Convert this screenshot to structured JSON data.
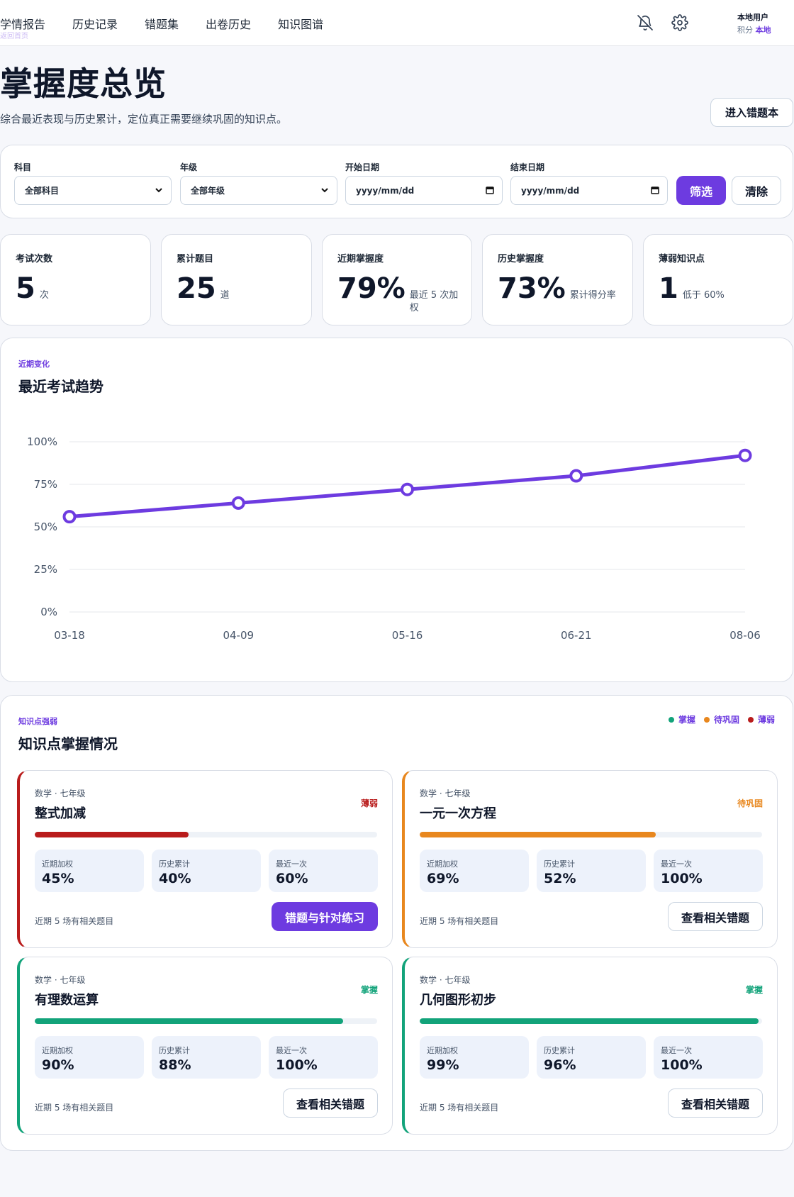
{
  "nav": {
    "links": [
      "学情报告",
      "历史记录",
      "错题集",
      "出卷历史",
      "知识图谱"
    ],
    "active_hint": "返回首页"
  },
  "user": {
    "name": "本地用户",
    "points_label": "积分",
    "points_value": "本地"
  },
  "icons": {
    "bell": "bell-off-icon",
    "settings": "gear-icon"
  },
  "header": {
    "title": "掌握度总览",
    "subtitle": "综合最近表现与历史累计，定位真正需要继续巩固的知识点。",
    "goto_button": "进入错题本"
  },
  "filters": {
    "subject_label": "科目",
    "subject_value": "全部科目",
    "grade_label": "年级",
    "grade_value": "全部年级",
    "start_label": "开始日期",
    "start_placeholder": "yyyy/mm/dd",
    "end_label": "结束日期",
    "end_placeholder": "yyyy/mm/dd",
    "filter_button": "筛选",
    "clear_button": "清除"
  },
  "stats": [
    {
      "label": "考试次数",
      "value": "5",
      "unit": "次"
    },
    {
      "label": "累计题目",
      "value": "25",
      "unit": "道"
    },
    {
      "label": "近期掌握度",
      "value": "79%",
      "unit": "最近 5 次加权"
    },
    {
      "label": "历史掌握度",
      "value": "73%",
      "unit": "累计得分率"
    },
    {
      "label": "薄弱知识点",
      "value": "1",
      "unit": "低于 60%"
    }
  ],
  "trend": {
    "eyebrow": "近期变化",
    "title": "最近考试趋势"
  },
  "chart_data": {
    "type": "line",
    "x": [
      "03-18",
      "04-09",
      "05-16",
      "06-21",
      "08-06"
    ],
    "series": [
      {
        "values": [
          56,
          64,
          72,
          80,
          92
        ]
      }
    ],
    "ylim": [
      0,
      100
    ],
    "yticks": [
      "0%",
      "25%",
      "50%",
      "75%",
      "100%"
    ],
    "ytick_values": [
      0,
      25,
      50,
      75,
      100
    ],
    "grid": true,
    "color": "#6d3be0"
  },
  "knowledge": {
    "eyebrow": "知识点强弱",
    "title": "知识点掌握情况",
    "legend": [
      {
        "label": "掌握",
        "color": "#12a37a"
      },
      {
        "label": "待巩固",
        "color": "#e8871e"
      },
      {
        "label": "薄弱",
        "color": "#b91c1c"
      }
    ],
    "metric_labels": [
      "近期加权",
      "历史累计",
      "最近一次"
    ],
    "items": [
      {
        "meta": "数学 · 七年级",
        "name": "整式加减",
        "status": "薄弱",
        "color": "#b91c1c",
        "progress": 0.45,
        "recent": "45%",
        "history": "40%",
        "last": "60%",
        "foot": "近期 5 场有相关题目",
        "action": "错题与针对练习",
        "primary": true
      },
      {
        "meta": "数学 · 七年级",
        "name": "一元一次方程",
        "status": "待巩固",
        "color": "#e8871e",
        "progress": 0.69,
        "recent": "69%",
        "history": "52%",
        "last": "100%",
        "foot": "近期 5 场有相关题目",
        "action": "查看相关错题",
        "primary": false
      },
      {
        "meta": "数学 · 七年级",
        "name": "有理数运算",
        "status": "掌握",
        "color": "#12a37a",
        "progress": 0.9,
        "recent": "90%",
        "history": "88%",
        "last": "100%",
        "foot": "近期 5 场有相关题目",
        "action": "查看相关错题",
        "primary": false
      },
      {
        "meta": "数学 · 七年级",
        "name": "几何图形初步",
        "status": "掌握",
        "color": "#12a37a",
        "progress": 0.99,
        "recent": "99%",
        "history": "96%",
        "last": "100%",
        "foot": "近期 5 场有相关题目",
        "action": "查看相关错题",
        "primary": false
      }
    ]
  }
}
